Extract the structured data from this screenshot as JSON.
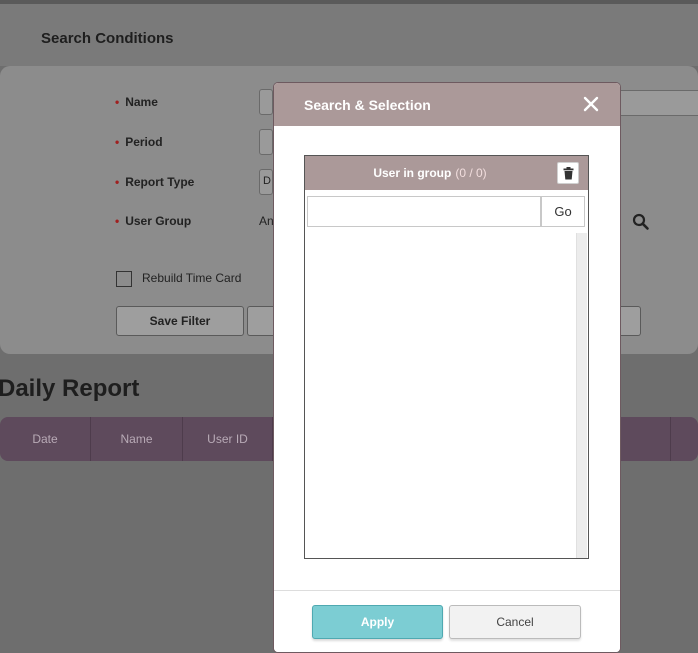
{
  "background": {
    "search_conditions_title": "Search Conditions",
    "fields": {
      "name_label": "Name",
      "period_label": "Period",
      "report_type_label": "Report Type",
      "report_type_value": "D",
      "user_group_label": "User Group",
      "user_group_value": "An"
    },
    "rebuild_time_card_label": "Rebuild Time Card",
    "save_filter_label": "Save Filter",
    "daily_report_title": "Daily Report",
    "table_columns": [
      "Date",
      "Name",
      "User ID"
    ]
  },
  "modal": {
    "title": "Search & Selection",
    "group_header": {
      "label": "User in group",
      "count": "(0 / 0)"
    },
    "search": {
      "value": "",
      "go_label": "Go"
    },
    "apply_label": "Apply",
    "cancel_label": "Cancel"
  },
  "colors": {
    "modal_header": "#ab9999",
    "apply_button": "#7ccdd3",
    "table_header": "#5e4a5c",
    "overlay": "#6e6e6e"
  }
}
